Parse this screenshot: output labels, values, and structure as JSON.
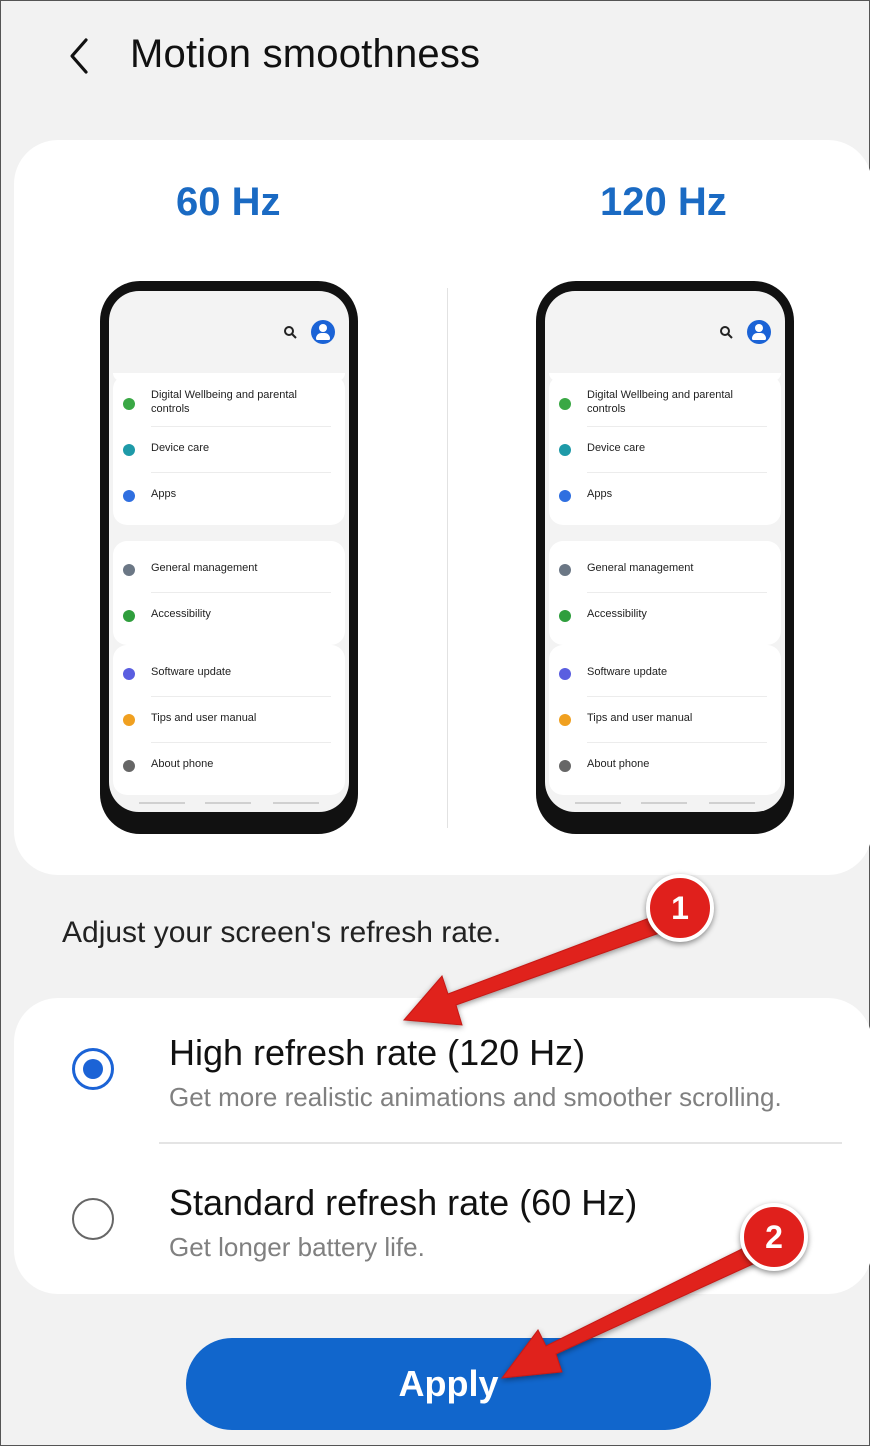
{
  "header": {
    "title": "Motion smoothness",
    "back_icon": "chevron-left-icon"
  },
  "preview": {
    "left_label": "60 Hz",
    "right_label": "120 Hz",
    "phone_screen": {
      "icons": [
        "search-icon",
        "account-icon"
      ],
      "items": [
        {
          "label": "Digital Wellbeing and parental controls",
          "icon": "wellbeing-icon",
          "color": "#3aa845"
        },
        {
          "label": "Device care",
          "icon": "device-care-icon",
          "color": "#1e9aa8"
        },
        {
          "label": "Apps",
          "icon": "apps-icon",
          "color": "#2f6fe0"
        },
        {
          "label": "General management",
          "icon": "general-management-icon",
          "color": "#6b7785"
        },
        {
          "label": "Accessibility",
          "icon": "accessibility-icon",
          "color": "#2f9e3d"
        },
        {
          "label": "Software update",
          "icon": "software-update-icon",
          "color": "#5a5ee0"
        },
        {
          "label": "Tips and user manual",
          "icon": "tips-icon",
          "color": "#f0a020"
        },
        {
          "label": "About phone",
          "icon": "about-phone-icon",
          "color": "#666666"
        }
      ]
    }
  },
  "description": "Adjust your screen's refresh rate.",
  "options": {
    "high": {
      "title": "High refresh rate (120 Hz)",
      "subtitle": "Get more realistic animations and smoother scrolling.",
      "selected": true
    },
    "standard": {
      "title": "Standard refresh rate (60 Hz)",
      "subtitle": "Get longer battery life.",
      "selected": false
    }
  },
  "apply_label": "Apply",
  "annotations": {
    "badge_1": "1",
    "badge_2": "2",
    "color": "#e0201c"
  },
  "colors": {
    "accent": "#1b63d6",
    "hz_label": "#1a6ac3",
    "apply_bg": "#1166cc"
  }
}
